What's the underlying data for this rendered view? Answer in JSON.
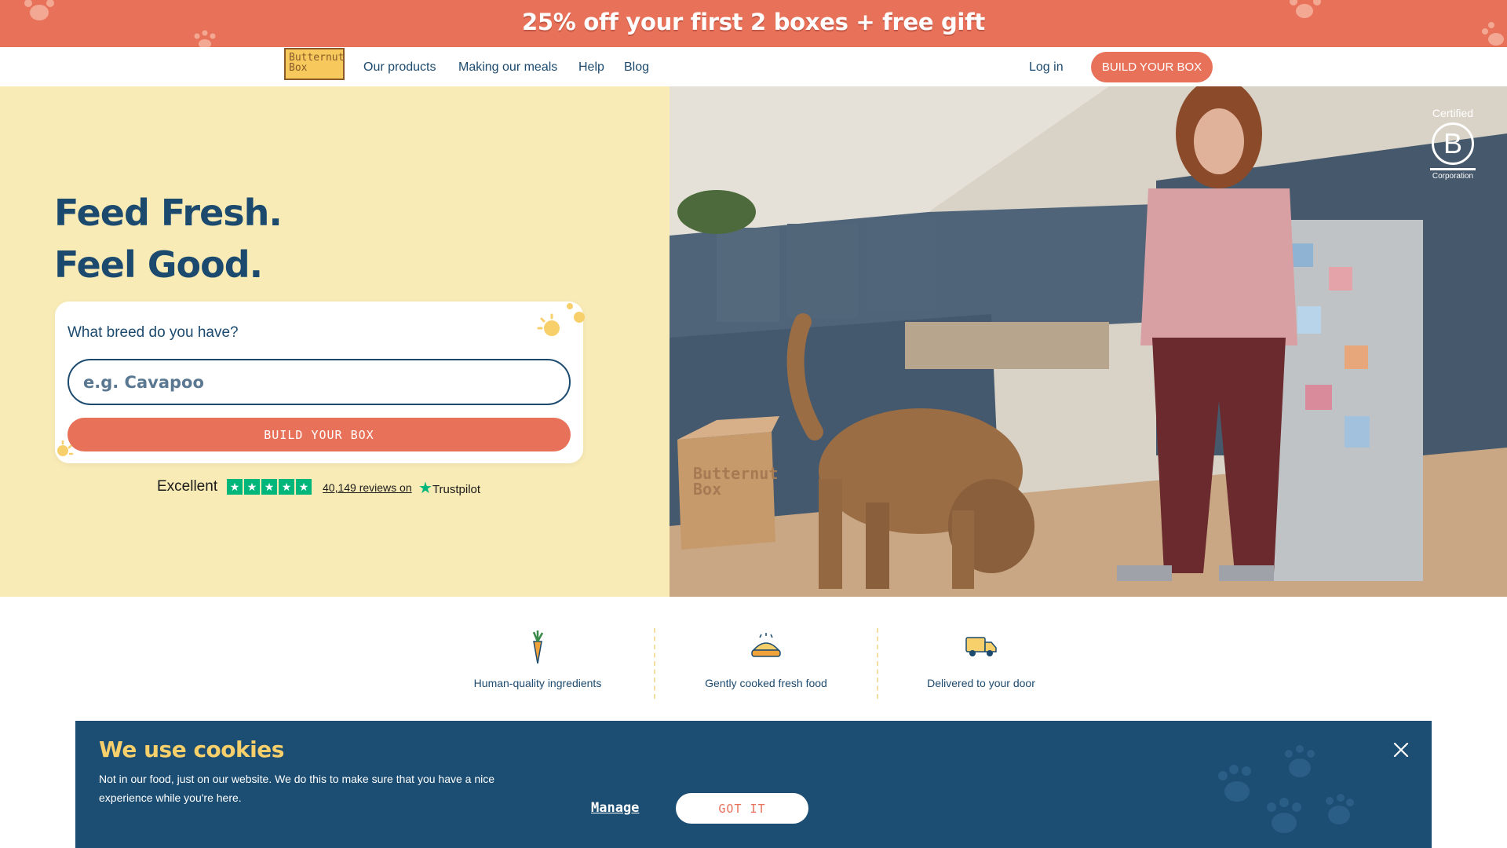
{
  "promo": {
    "text": "25% off your first 2 boxes + free gift"
  },
  "nav": {
    "logo_line1": "Butternut",
    "logo_line2": "Box",
    "links": [
      "Our products",
      "Making our meals",
      "Help",
      "Blog"
    ],
    "login": "Log in",
    "cta": "BUILD YOUR BOX"
  },
  "hero": {
    "headline_line1": "Feed Fresh.",
    "headline_line2": "Feel Good.",
    "breed_question": "What breed do you have?",
    "breed_placeholder": "e.g. Cavapoo",
    "cta": "BUILD YOUR BOX",
    "box_text_line1": "Butternut",
    "box_text_line2": "Box"
  },
  "trustpilot": {
    "rating_text": "Excellent",
    "stars": 5,
    "reviews": "40,149 reviews on",
    "brand": "Trustpilot"
  },
  "bcorp": {
    "top": "Certified",
    "letter": "B",
    "bottom": "Corporation"
  },
  "features": [
    {
      "label": "Human-quality ingredients",
      "icon": "carrot-icon"
    },
    {
      "label": "Gently cooked fresh food",
      "icon": "food-bowl-icon"
    },
    {
      "label": "Delivered to your door",
      "icon": "delivery-van-icon"
    }
  ],
  "cookies": {
    "title": "We use cookies",
    "text": "Not in our food, just on our website. We do this to make sure that you have a nice experience while you're here.",
    "manage": "Manage",
    "accept": "GOT IT"
  },
  "colors": {
    "brand_coral": "#e8715a",
    "navy": "#1c4a6e",
    "cream": "#f9ebb6",
    "trustpilot_green": "#00b67a",
    "cookie_bg": "#1c4e73",
    "cookie_title": "#f7cf6b"
  }
}
